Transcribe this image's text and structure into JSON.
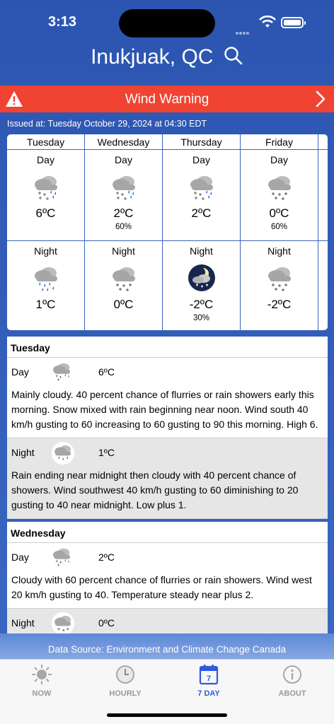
{
  "status": {
    "time": "3:13"
  },
  "header": {
    "title": "Inukjuak, QC"
  },
  "warning": {
    "label": "Wind Warning"
  },
  "issued": "Issued at: Tuesday October 29, 2024 at 04:30 EDT",
  "forecast_days": [
    {
      "day": "Tuesday",
      "day_period": {
        "label": "Day",
        "icon": "rain-snow-icon",
        "temp": "6ºC",
        "pop": ""
      },
      "night_period": {
        "label": "Night",
        "icon": "rain-cloud-icon",
        "temp": "1ºC",
        "pop": ""
      }
    },
    {
      "day": "Wednesday",
      "day_period": {
        "label": "Day",
        "icon": "rain-snow-icon",
        "temp": "2ºC",
        "pop": "60%"
      },
      "night_period": {
        "label": "Night",
        "icon": "snow-cloud-icon",
        "temp": "0ºC",
        "pop": ""
      }
    },
    {
      "day": "Thursday",
      "day_period": {
        "label": "Day",
        "icon": "rain-snow-icon",
        "temp": "2ºC",
        "pop": ""
      },
      "night_period": {
        "label": "Night",
        "icon": "moon-snow-icon",
        "temp": "-2ºC",
        "pop": "30%"
      }
    },
    {
      "day": "Friday",
      "day_period": {
        "label": "Day",
        "icon": "snow-cloud-icon",
        "temp": "0ºC",
        "pop": "60%"
      },
      "night_period": {
        "label": "Night",
        "icon": "snow-cloud-icon",
        "temp": "-2ºC",
        "pop": ""
      }
    }
  ],
  "details": [
    {
      "day": "Tuesday",
      "periods": [
        {
          "name": "Day",
          "icon": "rain-snow-icon",
          "temp": "6ºC",
          "text": "Mainly cloudy. 40 percent chance of flurries or rain showers early this morning. Snow mixed with rain beginning near noon. Wind south 40 km/h gusting to 60 increasing to 60 gusting to 90 this morning. High 6."
        },
        {
          "name": "Night",
          "icon": "rain-cloud-icon",
          "temp": "1ºC",
          "text": "Rain ending near midnight then cloudy with 40 percent chance of showers. Wind southwest 40 km/h gusting to 60 diminishing to 20 gusting to 40 near midnight. Low plus 1."
        }
      ]
    },
    {
      "day": "Wednesday",
      "periods": [
        {
          "name": "Day",
          "icon": "rain-snow-icon",
          "temp": "2ºC",
          "text": "Cloudy with 60 percent chance of flurries or rain showers. Wind west 20 km/h gusting to 40. Temperature steady near plus 2."
        },
        {
          "name": "Night",
          "icon": "snow-cloud-icon",
          "temp": "0ºC",
          "text": ""
        }
      ]
    }
  ],
  "footer": {
    "source": "Data Source: Environment and Climate Change Canada"
  },
  "tabs": [
    {
      "label": "NOW",
      "icon": "sun-icon"
    },
    {
      "label": "HOURLY",
      "icon": "clock-icon"
    },
    {
      "label": "7 DAY",
      "icon": "calendar-icon",
      "badge": "7"
    },
    {
      "label": "ABOUT",
      "icon": "info-icon"
    }
  ],
  "colors": {
    "accent": "#2f5ae0",
    "warning": "#f04332",
    "background": "#3461bd"
  }
}
